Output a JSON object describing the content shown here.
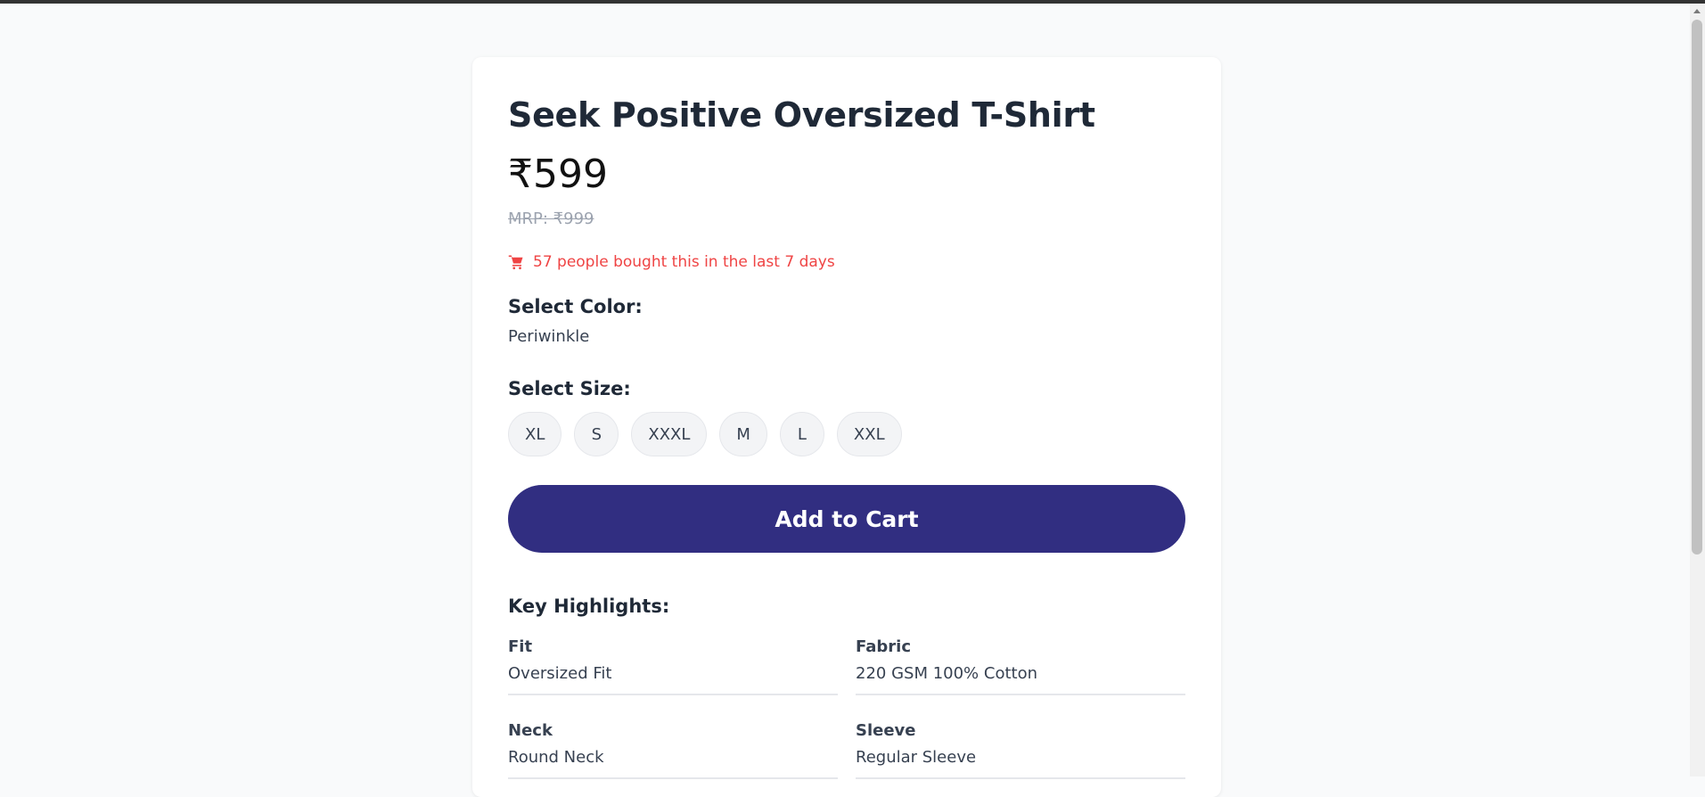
{
  "product": {
    "title": "Seek Positive Oversized T-Shirt",
    "price": "₹599",
    "mrp": "MRP: ₹999",
    "social_proof": "57 people bought this in the last 7 days"
  },
  "color": {
    "label": "Select Color:",
    "selected": "Periwinkle"
  },
  "size": {
    "label": "Select Size:",
    "options": [
      "XL",
      "S",
      "XXXL",
      "M",
      "L",
      "XXL"
    ]
  },
  "cta": {
    "add_to_cart": "Add to Cart"
  },
  "highlights": {
    "label": "Key Highlights:",
    "items": [
      {
        "label": "Fit",
        "value": "Oversized Fit"
      },
      {
        "label": "Fabric",
        "value": "220 GSM 100% Cotton"
      },
      {
        "label": "Neck",
        "value": "Round Neck"
      },
      {
        "label": "Sleeve",
        "value": "Regular Sleeve"
      }
    ]
  },
  "icons": {
    "social_proof": "shopping-cart-icon"
  },
  "colors": {
    "accent": "#312e81",
    "alert": "#ef4444",
    "page_bg": "#f9fafb"
  }
}
